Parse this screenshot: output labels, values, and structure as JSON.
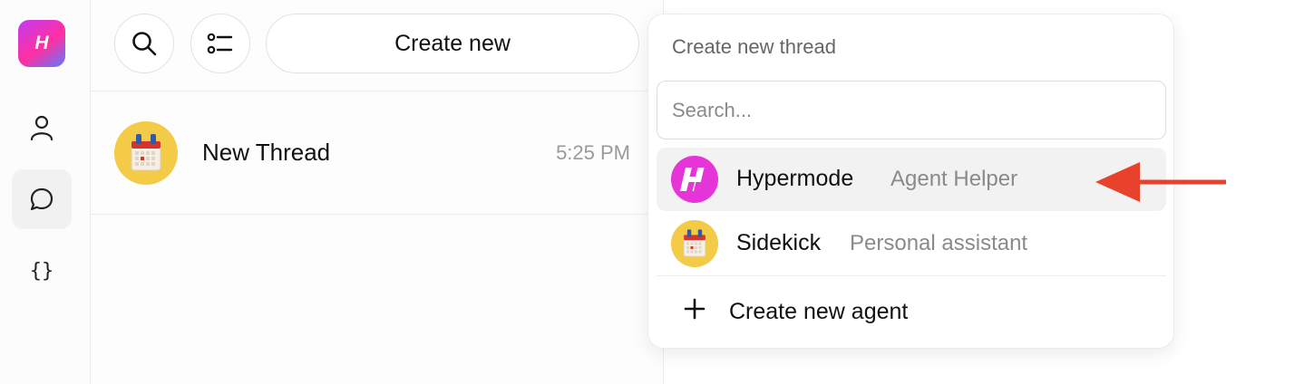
{
  "app": {
    "logo_letter": "H"
  },
  "rail": {
    "items": [
      {
        "icon": "user-icon"
      },
      {
        "icon": "chat-bubble-icon",
        "active": true
      },
      {
        "icon": "braces-icon",
        "glyph": "{}"
      }
    ]
  },
  "toolbar": {
    "search_icon": "search-icon",
    "filter_icon": "list-filter-icon",
    "create_label": "Create new"
  },
  "threads": [
    {
      "title": "New Thread",
      "time": "5:25 PM",
      "avatar": "calendar-emoji"
    }
  ],
  "dropdown": {
    "heading": "Create new thread",
    "search_placeholder": "Search...",
    "agents": [
      {
        "name": "Hypermode",
        "description": "Agent Helper",
        "avatar": "hypermode-logo",
        "highlighted": true
      },
      {
        "name": "Sidekick",
        "description": "Personal assistant",
        "avatar": "calendar-emoji",
        "highlighted": false
      }
    ],
    "create_agent_label": "Create new agent"
  },
  "annotation": {
    "arrow_color": "#e8412c"
  },
  "colors": {
    "brand_magenta": "#e535d8",
    "avatar_yellow": "#f4cb46"
  }
}
